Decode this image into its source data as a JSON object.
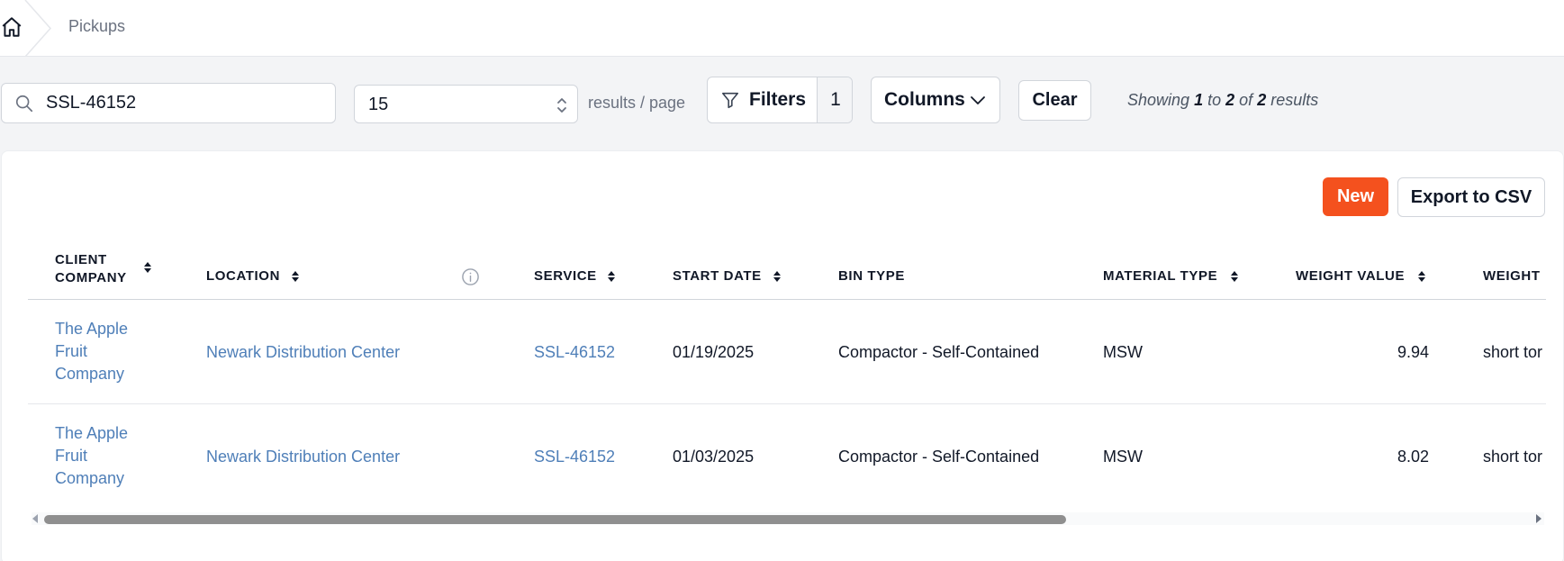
{
  "breadcrumb": {
    "home_icon": "home-icon",
    "current": "Pickups"
  },
  "search": {
    "value": "SSL-46152",
    "icon": "search-icon"
  },
  "per_page": {
    "value": "15",
    "label": "results / page"
  },
  "filters": {
    "label": "Filters",
    "count": "1",
    "icon": "filter-icon"
  },
  "columns_button": {
    "label": "Columns",
    "icon": "chevron-down-icon"
  },
  "clear_button": {
    "label": "Clear"
  },
  "showing": {
    "prefix": "Showing",
    "from": "1",
    "to_word": "to",
    "to": "2",
    "of_word": "of",
    "total": "2",
    "suffix": "results"
  },
  "actions": {
    "new_label": "New",
    "export_label": "Export to CSV"
  },
  "table": {
    "columns": [
      {
        "key": "client_company",
        "label": "Client Company",
        "sortable": true
      },
      {
        "key": "location",
        "label": "Location",
        "sortable": true,
        "info": true
      },
      {
        "key": "service",
        "label": "Service",
        "sortable": true
      },
      {
        "key": "start_date",
        "label": "Start Date",
        "sortable": true
      },
      {
        "key": "bin_type",
        "label": "Bin Type",
        "sortable": false
      },
      {
        "key": "material_type",
        "label": "Material Type",
        "sortable": true
      },
      {
        "key": "weight_value",
        "label": "Weight Value",
        "sortable": true
      },
      {
        "key": "weight_unit",
        "label": "Weight",
        "sortable": false
      }
    ],
    "rows": [
      {
        "client_company": "The Apple Fruit Company",
        "location": "Newark Distribution Center",
        "service": "SSL-46152",
        "start_date": "01/19/2025",
        "bin_type": "Compactor - Self-Contained",
        "material_type": "MSW",
        "weight_value": "9.94",
        "weight_unit": "short tor"
      },
      {
        "client_company": "The Apple Fruit Company",
        "location": "Newark Distribution Center",
        "service": "SSL-46152",
        "start_date": "01/03/2025",
        "bin_type": "Compactor - Self-Contained",
        "material_type": "MSW",
        "weight_value": "8.02",
        "weight_unit": "short tor"
      }
    ]
  },
  "colors": {
    "accent": "#f4511e",
    "link": "#4f7fb8",
    "page_bg": "#f3f4f6",
    "scroll_thumb": "#8f8f8f"
  }
}
